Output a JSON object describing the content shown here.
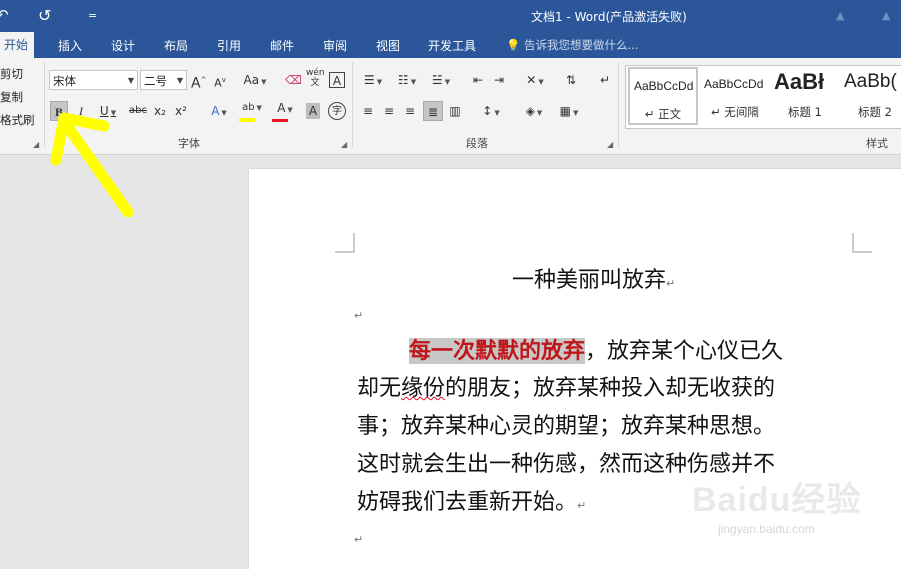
{
  "window": {
    "title": "文档1 - Word(产品激活失败)",
    "qat": {
      "undo_glyph": "↶",
      "redo_glyph": "↺",
      "customize_glyph": "="
    }
  },
  "tabs": [
    "开始",
    "插入",
    "设计",
    "布局",
    "引用",
    "邮件",
    "审阅",
    "视图",
    "开发工具"
  ],
  "tell_me": "告诉我您想要做什么...",
  "clipboard": {
    "cut": "剪切",
    "copy": "复制",
    "format_painter": "格式刷"
  },
  "font": {
    "name": "宋体",
    "size": "二号",
    "grow": "A",
    "shrink": "A",
    "case": "Aa",
    "phonetic": "wén",
    "char_border": "A",
    "bold": "B",
    "italic": "I",
    "underline": "U",
    "strikethrough": "abc",
    "subscript": "x₂",
    "superscript": "x²",
    "text_effects": "A",
    "highlight": "ab",
    "font_color": "A",
    "char_shading": "A",
    "enclose": "字",
    "group_label": "字体",
    "highlight_color": "#ffff00",
    "font_color_value": "#e81123"
  },
  "paragraph": {
    "group_label": "段落"
  },
  "styles": {
    "group_label": "样式",
    "items": [
      {
        "preview": "AaBbCcDd",
        "name": "正文",
        "selected": true
      },
      {
        "preview": "AaBbCcDd",
        "name": "无间隔",
        "selected": false
      },
      {
        "preview": "AaBł",
        "name": "标题 1",
        "selected": false
      },
      {
        "preview": "AaBb(",
        "name": "标题 2",
        "selected": false
      }
    ]
  },
  "document": {
    "title": "一种美丽叫放弃",
    "pmark": "↵",
    "para_highlight": "每一次默默的放弃",
    "line1_rest": "，放弃某个心仪已久",
    "line2_a": "却无",
    "line2_squiggle": "缘份",
    "line2_b": "的朋友；放弃某种投入却无收获的",
    "line3": "事；放弃某种心灵的期望；放弃某种思想。",
    "line4": "这时就会生出一种伤感，然而这种伤感并不",
    "line5": "妨碍我们去重新开始。",
    "highlight_text_color": "#c0161b"
  },
  "watermark": {
    "brand": "Baidu经验",
    "url": "jingyan.baidu.com"
  },
  "colors": {
    "accent": "#2b579a",
    "annotation": "#ffff00"
  }
}
